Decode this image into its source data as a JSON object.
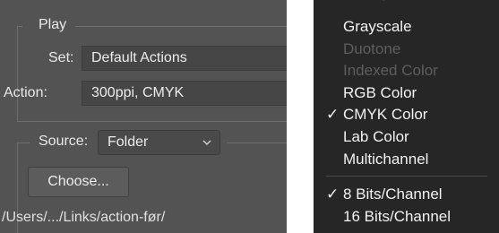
{
  "batch": {
    "play_legend": "Play",
    "set_label": "Set:",
    "set_value": "Default Actions",
    "action_label": "Action:",
    "action_value": "300ppi, CMYK",
    "source_label": "Source:",
    "source_value": "Folder",
    "choose_button": "Choose...",
    "source_path": "/Users/.../Links/action-før/"
  },
  "menu": {
    "items": [
      {
        "label": "Grayscale",
        "enabled": true,
        "checked": false
      },
      {
        "label": "Duotone",
        "enabled": false,
        "checked": false
      },
      {
        "label": "Indexed Color",
        "enabled": false,
        "checked": false
      },
      {
        "label": "RGB Color",
        "enabled": true,
        "checked": false
      },
      {
        "label": "CMYK Color",
        "enabled": true,
        "checked": true
      },
      {
        "label": "Lab Color",
        "enabled": true,
        "checked": false
      },
      {
        "label": "Multichannel",
        "enabled": true,
        "checked": false
      }
    ],
    "bit_items": [
      {
        "label": "8 Bits/Channel",
        "enabled": true,
        "checked": true
      },
      {
        "label": "16 Bits/Channel",
        "enabled": true,
        "checked": false
      }
    ],
    "check_glyph": "✓"
  },
  "icons": {
    "dropdown": "chevron-down-icon",
    "checkmark": "checkmark-icon"
  },
  "colors": {
    "dialog_bg": "#535353",
    "menu_bg": "#262626",
    "disabled_text": "#5e5e5e"
  }
}
